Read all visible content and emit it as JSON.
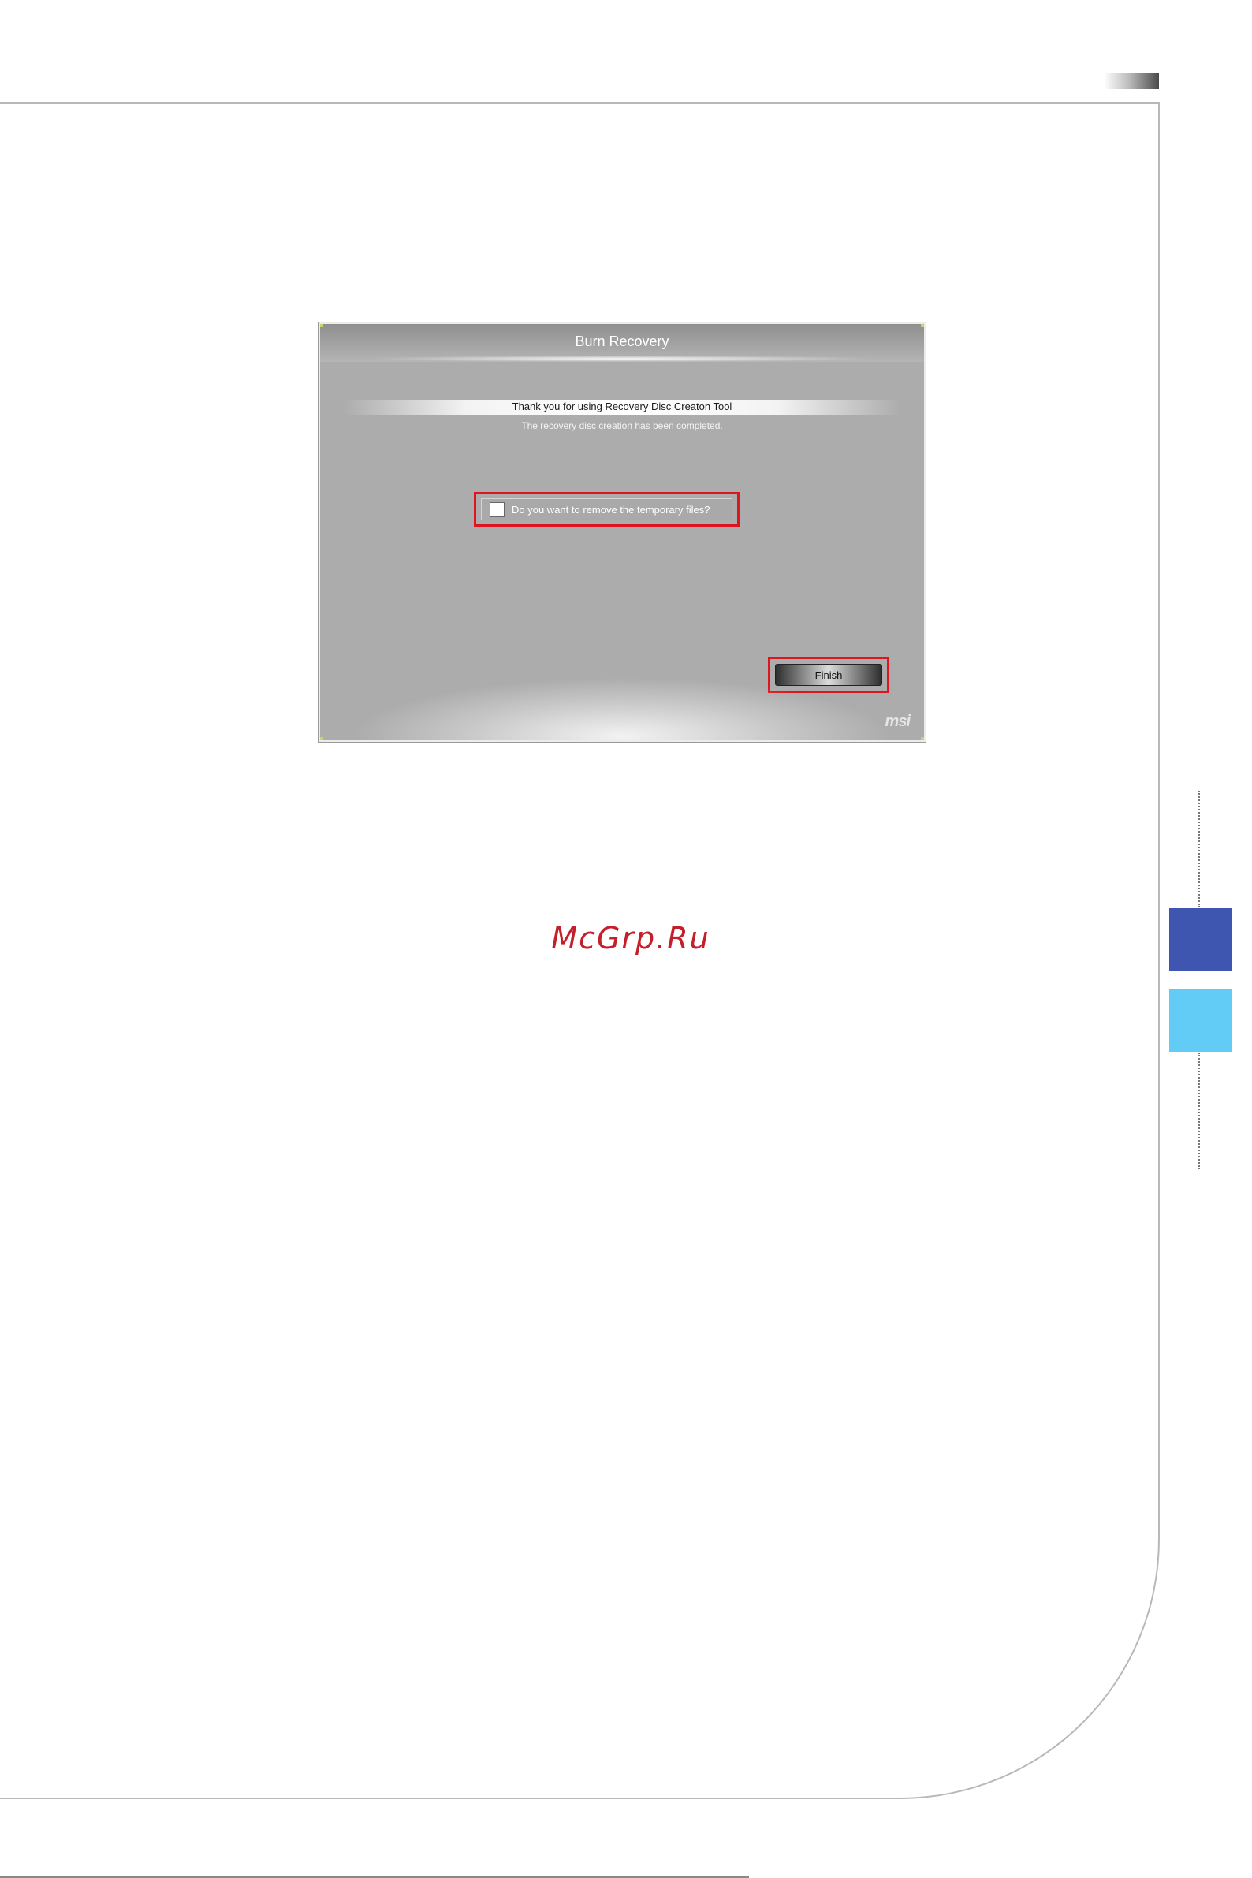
{
  "dialog": {
    "title": "Burn Recovery",
    "banner_text": "Thank you for using Recovery Disc Creaton Tool",
    "subtitle": "The recovery disc creation has been completed.",
    "checkbox_label": "Do you want to remove the temporary files?",
    "checkbox_checked": false,
    "finish_label": "Finish",
    "logo_text": "msi",
    "highlight_color": "#e0141e"
  },
  "watermark": "McGrp.Ru",
  "colors": {
    "side_tab_dark": "#3f56b0",
    "side_tab_light": "#62ccf6"
  }
}
